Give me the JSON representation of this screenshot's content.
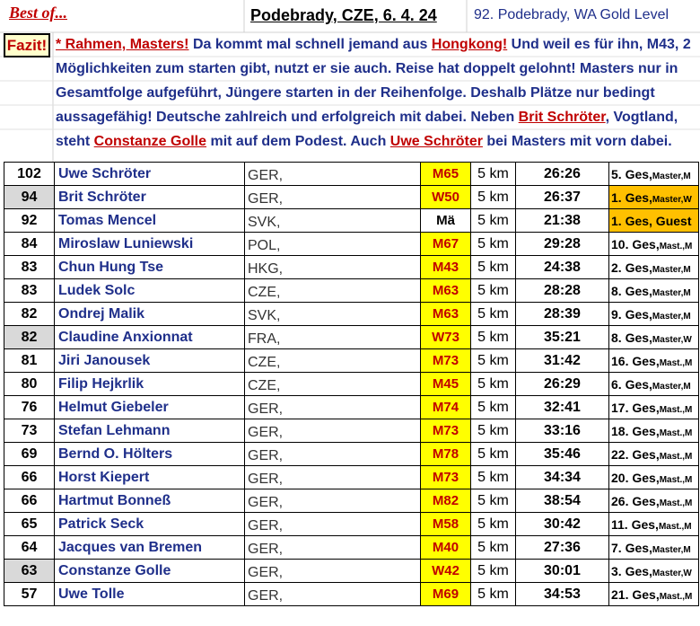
{
  "header": {
    "best_of": "Best of...",
    "title": "Podebrady, CZE, 6. 4. 24",
    "event": "92. Podebrady, WA Gold Level"
  },
  "fazit": {
    "label": "Fazit!",
    "parts": [
      {
        "t": "* Rahmen, Masters!",
        "hl": true
      },
      {
        "t": " Da kommt mal schnell jemand aus ",
        "hl": false
      },
      {
        "t": "Hongkong!",
        "hl": true
      },
      {
        "t": " Und weil es für ihn, M43, 2 Möglichkeiten zum starten gibt, nutzt er sie auch. Reise hat doppelt gelohnt! Masters nur in Gesamtfolge aufgeführt, Jüngere starten in der Reihenfolge. Deshalb Plätze nur bedingt aussagefähig! Deutsche zahlreich und erfolgreich mit dabei. Neben ",
        "hl": false
      },
      {
        "t": "Brit Schröter",
        "hl": true
      },
      {
        "t": ", Vogtland, steht ",
        "hl": false
      },
      {
        "t": "Constanze Golle",
        "hl": true
      },
      {
        "t": " mit auf dem Podest. Auch ",
        "hl": false
      },
      {
        "t": "Uwe Schröter",
        "hl": true
      },
      {
        "t": " bei Masters mit vorn dabei.",
        "hl": false
      }
    ]
  },
  "results": [
    {
      "points": "102",
      "name": "Uwe Schröter",
      "nat": "GER,",
      "cls": "M65",
      "dist": "5 km",
      "time": "26:26",
      "place": "5. Ges,",
      "place_sub": "Master,M",
      "grey": false,
      "cls_plain": false,
      "gold": false
    },
    {
      "points": "94",
      "name": "Brit Schröter",
      "nat": "GER,",
      "cls": "W50",
      "dist": "5 km",
      "time": "26:37",
      "place": "1. Ges,",
      "place_sub": "Master,W",
      "grey": true,
      "cls_plain": false,
      "gold": true
    },
    {
      "points": "92",
      "name": "Tomas Mencel",
      "nat": "SVK,",
      "cls": "Mä",
      "dist": "5 km",
      "time": "21:38",
      "place": "1. Ges, Guest",
      "place_sub": "",
      "grey": false,
      "cls_plain": true,
      "gold": true
    },
    {
      "points": "84",
      "name": "Miroslaw Luniewski",
      "nat": "POL,",
      "cls": "M67",
      "dist": "5 km",
      "time": "29:28",
      "place": "10. Ges,",
      "place_sub": "Mast.,M",
      "grey": false,
      "cls_plain": false,
      "gold": false
    },
    {
      "points": "83",
      "name": "Chun Hung Tse",
      "nat": "HKG,",
      "cls": "M43",
      "dist": "5 km",
      "time": "24:38",
      "place": "2. Ges,",
      "place_sub": "Master,M",
      "grey": false,
      "cls_plain": false,
      "gold": false
    },
    {
      "points": "83",
      "name": "Ludek Solc",
      "nat": "CZE,",
      "cls": "M63",
      "dist": "5 km",
      "time": "28:28",
      "place": "8. Ges,",
      "place_sub": "Master,M",
      "grey": false,
      "cls_plain": false,
      "gold": false
    },
    {
      "points": "82",
      "name": "Ondrej Malik",
      "nat": "SVK,",
      "cls": "M63",
      "dist": "5 km",
      "time": "28:39",
      "place": "9. Ges,",
      "place_sub": "Master,M",
      "grey": false,
      "cls_plain": false,
      "gold": false
    },
    {
      "points": "82",
      "name": "Claudine Anxionnat",
      "nat": "FRA,",
      "cls": "W73",
      "dist": "5 km",
      "time": "35:21",
      "place": "8. Ges,",
      "place_sub": "Master,W",
      "grey": true,
      "cls_plain": false,
      "gold": false
    },
    {
      "points": "81",
      "name": "Jiri Janousek",
      "nat": "CZE,",
      "cls": "M73",
      "dist": "5 km",
      "time": "31:42",
      "place": "16. Ges,",
      "place_sub": "Mast.,M",
      "grey": false,
      "cls_plain": false,
      "gold": false
    },
    {
      "points": "80",
      "name": "Filip Hejkrlik",
      "nat": "CZE,",
      "cls": "M45",
      "dist": "5 km",
      "time": "26:29",
      "place": "6. Ges,",
      "place_sub": "Master,M",
      "grey": false,
      "cls_plain": false,
      "gold": false
    },
    {
      "points": "76",
      "name": "Helmut Giebeler",
      "nat": "GER,",
      "cls": "M74",
      "dist": "5 km",
      "time": "32:41",
      "place": "17. Ges,",
      "place_sub": "Mast.,M",
      "grey": false,
      "cls_plain": false,
      "gold": false
    },
    {
      "points": "73",
      "name": "Stefan Lehmann",
      "nat": "GER,",
      "cls": "M73",
      "dist": "5 km",
      "time": "33:16",
      "place": "18. Ges,",
      "place_sub": "Mast.,M",
      "grey": false,
      "cls_plain": false,
      "gold": false
    },
    {
      "points": "69",
      "name": "Bernd O. Hölters",
      "nat": "GER,",
      "cls": "M78",
      "dist": "5 km",
      "time": "35:46",
      "place": "22. Ges,",
      "place_sub": "Mast.,M",
      "grey": false,
      "cls_plain": false,
      "gold": false
    },
    {
      "points": "66",
      "name": "Horst Kiepert",
      "nat": "GER,",
      "cls": "M73",
      "dist": "5 km",
      "time": "34:34",
      "place": "20. Ges,",
      "place_sub": "Mast.,M",
      "grey": false,
      "cls_plain": false,
      "gold": false
    },
    {
      "points": "66",
      "name": "Hartmut Bonneß",
      "nat": "GER,",
      "cls": "M82",
      "dist": "5 km",
      "time": "38:54",
      "place": "26. Ges,",
      "place_sub": "Mast.,M",
      "grey": false,
      "cls_plain": false,
      "gold": false
    },
    {
      "points": "65",
      "name": "Patrick Seck",
      "nat": "GER,",
      "cls": "M58",
      "dist": "5 km",
      "time": "30:42",
      "place": "11. Ges,",
      "place_sub": "Mast.,M",
      "grey": false,
      "cls_plain": false,
      "gold": false
    },
    {
      "points": "64",
      "name": "Jacques van Bremen",
      "nat": "GER,",
      "cls": "M40",
      "dist": "5 km",
      "time": "27:36",
      "place": "7. Ges,",
      "place_sub": "Master,M",
      "grey": false,
      "cls_plain": false,
      "gold": false
    },
    {
      "points": "63",
      "name": "Constanze Golle",
      "nat": "GER,",
      "cls": "W42",
      "dist": "5 km",
      "time": "30:01",
      "place": "3. Ges,",
      "place_sub": "Master,W",
      "grey": true,
      "cls_plain": false,
      "gold": false
    },
    {
      "points": "57",
      "name": "Uwe Tolle",
      "nat": "GER,",
      "cls": "M69",
      "dist": "5 km",
      "time": "34:53",
      "place": "21. Ges,",
      "place_sub": "Mast.,M",
      "grey": false,
      "cls_plain": false,
      "gold": false
    }
  ]
}
